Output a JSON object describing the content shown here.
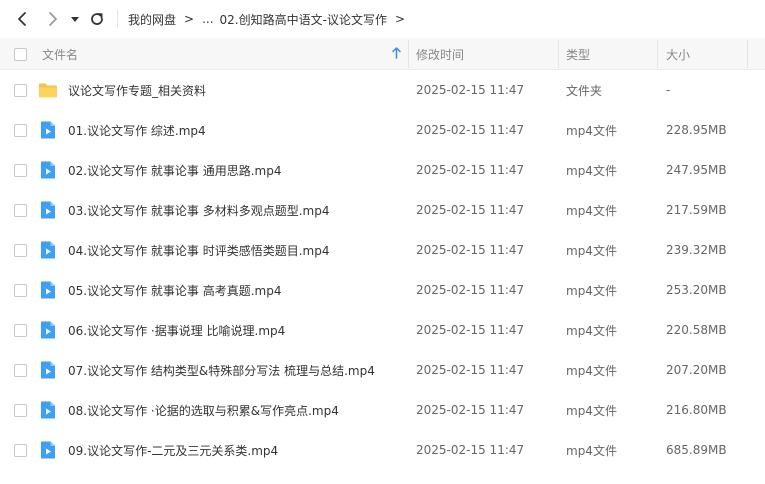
{
  "colors": {
    "accent": "#3a8ee6",
    "folder": "#f5c24c",
    "video_icon": "#3d9ff5"
  },
  "toolbar": {
    "back_icon": "chevron-left-icon",
    "forward_icon": "chevron-right-icon",
    "history_icon": "caret-down-icon",
    "refresh_icon": "refresh-icon"
  },
  "breadcrumb": {
    "items": [
      "我的网盘",
      "...",
      "02.创知路高中语文-议论文写作"
    ],
    "separator": ">"
  },
  "header": {
    "name": "文件名",
    "modified": "修改时间",
    "type": "类型",
    "size": "大小"
  },
  "files": [
    {
      "name": "议论文写作专题_相关资料",
      "modified": "2025-02-15 11:47",
      "type": "文件夹",
      "size": "-",
      "icon": "folder-icon"
    },
    {
      "name": "01.议论文写作 综述.mp4",
      "modified": "2025-02-15 11:47",
      "type": "mp4文件",
      "size": "228.95MB",
      "icon": "video-file-icon"
    },
    {
      "name": "02.议论文写作 就事论事 通用思路.mp4",
      "modified": "2025-02-15 11:47",
      "type": "mp4文件",
      "size": "247.95MB",
      "icon": "video-file-icon"
    },
    {
      "name": "03.议论文写作 就事论事 多材料多观点题型.mp4",
      "modified": "2025-02-15 11:47",
      "type": "mp4文件",
      "size": "217.59MB",
      "icon": "video-file-icon"
    },
    {
      "name": "04.议论文写作 就事论事 时评类感悟类题目.mp4",
      "modified": "2025-02-15 11:47",
      "type": "mp4文件",
      "size": "239.32MB",
      "icon": "video-file-icon"
    },
    {
      "name": "05.议论文写作 就事论事 高考真题.mp4",
      "modified": "2025-02-15 11:47",
      "type": "mp4文件",
      "size": "253.20MB",
      "icon": "video-file-icon"
    },
    {
      "name": "06.议论文写作 ·据事说理 比喻说理.mp4",
      "modified": "2025-02-15 11:47",
      "type": "mp4文件",
      "size": "220.58MB",
      "icon": "video-file-icon"
    },
    {
      "name": "07.议论文写作 结构类型&特殊部分写法 梳理与总结.mp4",
      "modified": "2025-02-15 11:47",
      "type": "mp4文件",
      "size": "207.20MB",
      "icon": "video-file-icon"
    },
    {
      "name": "08.议论文写作 ·论据的选取与积累&写作亮点.mp4",
      "modified": "2025-02-15 11:47",
      "type": "mp4文件",
      "size": "216.80MB",
      "icon": "video-file-icon"
    },
    {
      "name": "09.议论文写作-二元及三元关系类.mp4",
      "modified": "2025-02-15 11:47",
      "type": "mp4文件",
      "size": "685.89MB",
      "icon": "video-file-icon"
    }
  ]
}
